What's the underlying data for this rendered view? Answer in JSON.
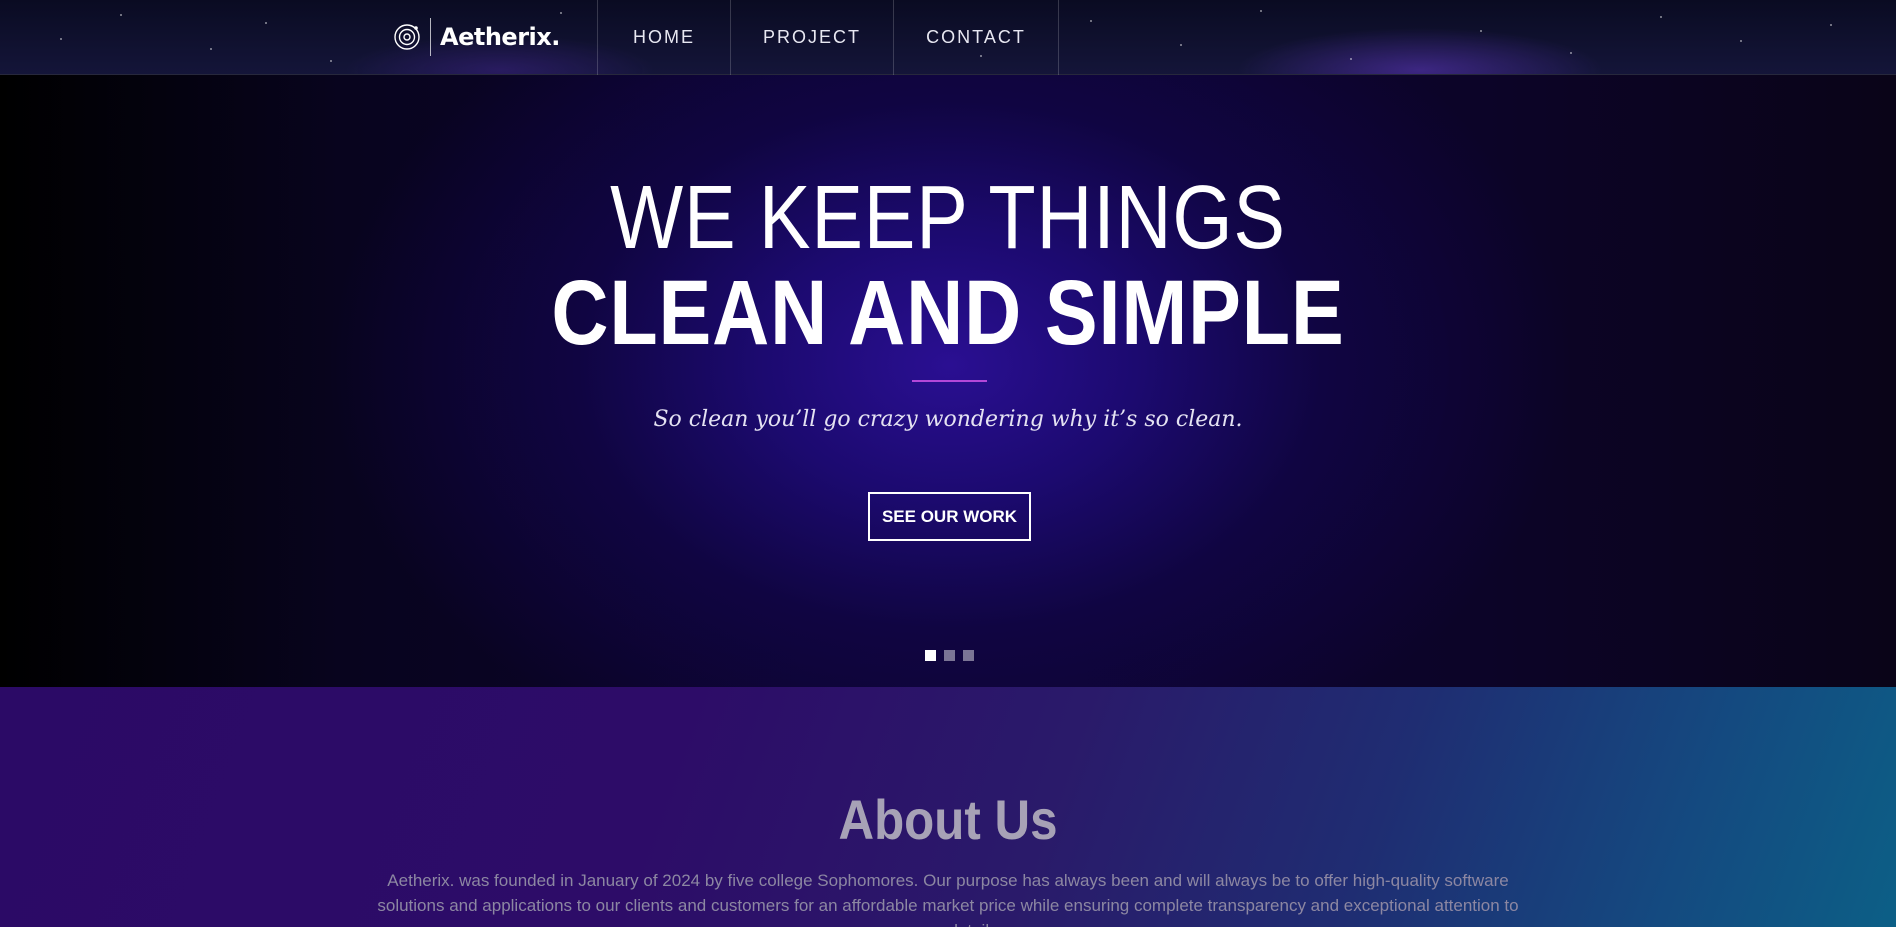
{
  "brand": {
    "name": "Aetherix."
  },
  "nav": {
    "items": [
      "HOME",
      "PROJECT",
      "CONTACT"
    ]
  },
  "hero": {
    "line1": "WE KEEP THINGS",
    "line2": "CLEAN AND SIMPLE",
    "subtitle": "So clean you’ll go crazy wondering why it’s so clean.",
    "cta_label": "SEE OUR WORK",
    "slider": {
      "count": 3,
      "active_index": 0
    }
  },
  "about": {
    "title": "About Us",
    "body": "Aetherix. was founded in January of 2024 by five college Sophomores. Our purpose has always been and will always be to offer high-quality software solutions and applications to our clients and customers for an affordable market price while ensuring complete transparency and exceptional attention to every detail."
  },
  "colors": {
    "accent_divider": "#b347d9",
    "hero_glow": "#2a0f92",
    "about_gradient_start": "#2b0a66",
    "about_gradient_end": "#0c5f86"
  }
}
